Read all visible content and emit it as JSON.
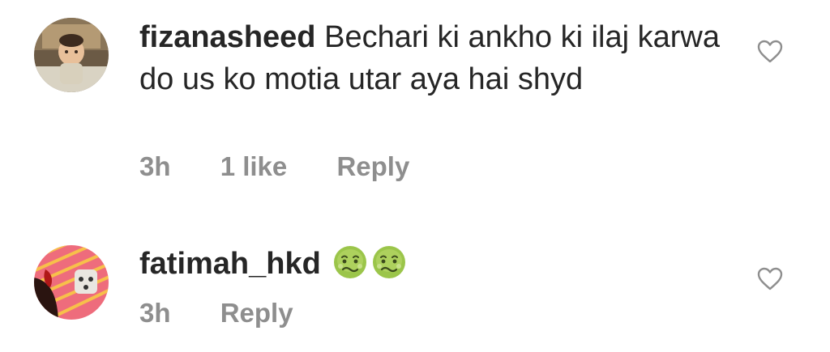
{
  "comments": [
    {
      "username": "fizanasheed",
      "text": "Bechari ki ankho ki ilaj karwa do us ko motia utar aya hai shyd",
      "time": "3h",
      "likes": "1 like",
      "reply_label": "Reply",
      "avatar": "child-photo-avatar",
      "like_icon": "heart-outline-icon"
    },
    {
      "username": "fatimah_hkd",
      "emojis": [
        "nauseated-face-emoji",
        "nauseated-face-emoji"
      ],
      "time": "3h",
      "reply_label": "Reply",
      "avatar": "striped-fabric-photo-avatar",
      "like_icon": "heart-outline-icon"
    }
  ],
  "colors": {
    "text": "#262626",
    "meta": "#8e8e8e",
    "heart": "#8e8e8e",
    "emoji_face": "#9bc54a"
  }
}
